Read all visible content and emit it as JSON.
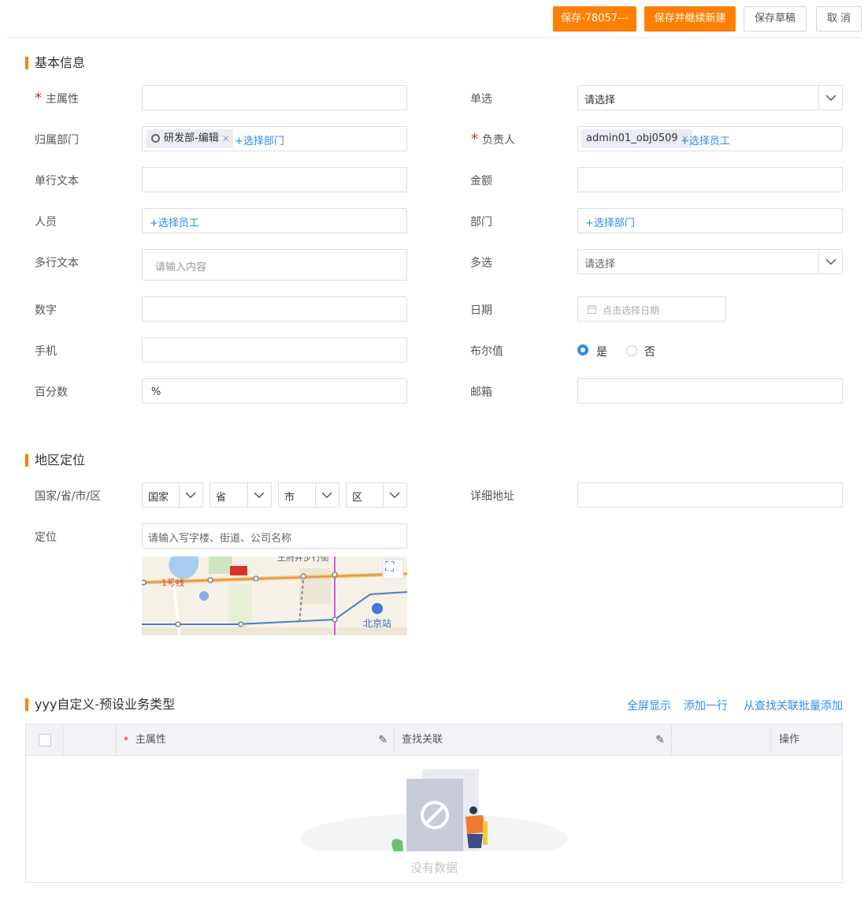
{
  "toolbar": {
    "save": "保存-78057---",
    "save_new": "保存并继续新建",
    "save_draft": "保存草稿",
    "cancel": "取 消"
  },
  "colors": {
    "accent": "#ff8000",
    "link": "#2d8cf0",
    "required": "#e5231b"
  },
  "basic": {
    "title": "基本信息",
    "main_attr_label": "主属性",
    "single_select_label": "单选",
    "single_select_value": "请选择",
    "dept_label": "归属部门",
    "dept_tag": "研发部-编辑",
    "dept_add": "+选择部门",
    "owner_label": "负责人",
    "owner_tag": "admin01_obj0509",
    "owner_add": "+选择员工",
    "single_text_label": "单行文本",
    "amount_label": "金额",
    "person_label": "人员",
    "person_add": "+选择员工",
    "department_label": "部门",
    "department_add": "+选择部门",
    "multiline_label": "多行文本",
    "multiline_placeholder": "请输入内容",
    "multi_select_label": "多选",
    "multi_select_placeholder": "请选择",
    "number_label": "数字",
    "date_label": "日期",
    "date_placeholder": "点击选择日期",
    "phone_label": "手机",
    "bool_label": "布尔值",
    "bool_yes": "是",
    "bool_no": "否",
    "bool_value": "是",
    "percent_label": "百分数",
    "percent_value": "%",
    "email_label": "邮箱"
  },
  "region": {
    "title": "地区定位",
    "area_label": "国家/省/市/区",
    "country": "国家",
    "province": "省",
    "city": "市",
    "district": "区",
    "address_label": "详细地址",
    "location_label": "定位",
    "location_placeholder": "请输入写字楼、街道、公司名称",
    "map_line_label": "1号线",
    "map_station": "北京站",
    "map_street": "王府井步行街"
  },
  "table_section": {
    "title": "yyy自定义-预设业务类型",
    "actions": [
      "全屏显示",
      "添加一行",
      "从查找关联批量添加"
    ],
    "columns": [
      "主属性",
      "查找关联",
      "操作"
    ],
    "empty_text": "没有数据"
  }
}
